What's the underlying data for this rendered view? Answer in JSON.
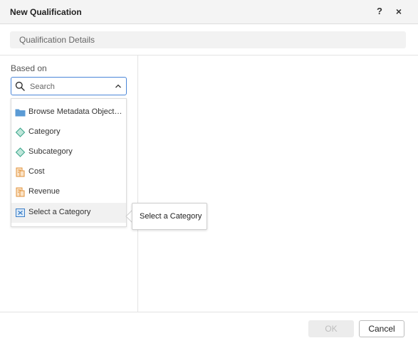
{
  "dialog": {
    "title": "New Qualification",
    "help_label": "?",
    "close_label": "×"
  },
  "section": {
    "title": "Qualification Details"
  },
  "based_on": {
    "label": "Based on",
    "search": {
      "placeholder": "Search",
      "value": ""
    },
    "items": [
      {
        "label": "Browse Metadata Objects...",
        "icon": "folder-icon"
      },
      {
        "label": "Category",
        "icon": "attribute-icon"
      },
      {
        "label": "Subcategory",
        "icon": "attribute-icon"
      },
      {
        "label": "Cost",
        "icon": "metric-icon"
      },
      {
        "label": "Revenue",
        "icon": "metric-icon"
      },
      {
        "label": "Select a Category",
        "icon": "prompt-icon",
        "selected": true
      }
    ]
  },
  "tooltip": {
    "text": "Select a Category"
  },
  "footer": {
    "ok_label": "OK",
    "cancel_label": "Cancel"
  },
  "colors": {
    "accent": "#4a86d8",
    "folder": "#5b9bd5",
    "attribute": "#3aa68b",
    "metric": "#e0913a",
    "prompt": "#3a7ec8"
  }
}
